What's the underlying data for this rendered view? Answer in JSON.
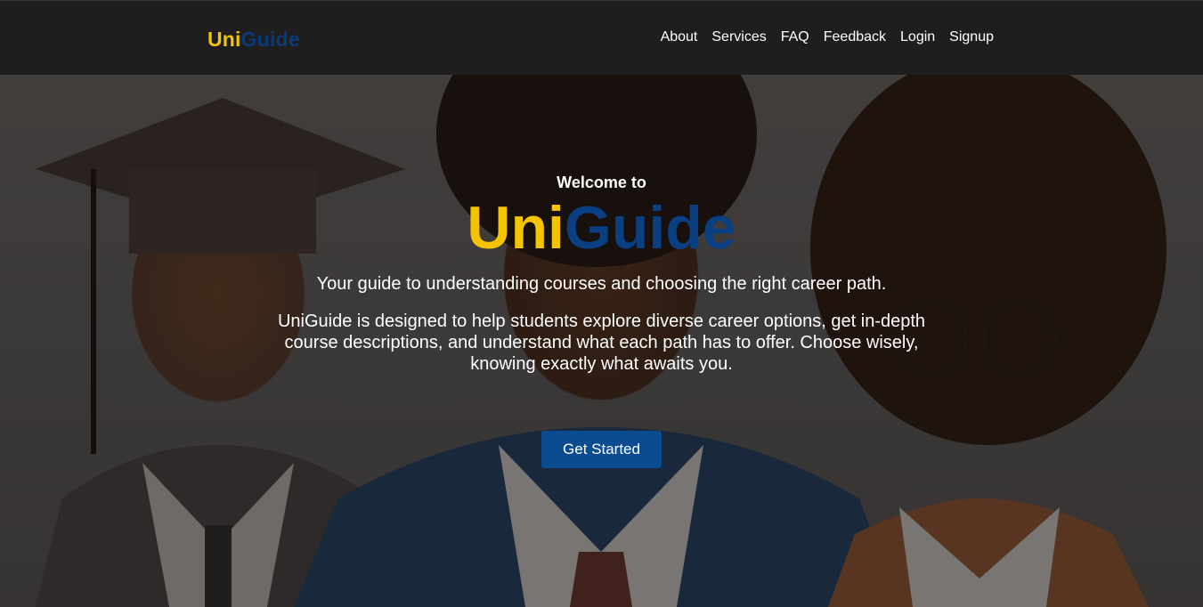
{
  "navbar": {
    "brand": {
      "part1": "Uni",
      "part2": "Guide"
    },
    "links": [
      {
        "label": "About"
      },
      {
        "label": "Services"
      },
      {
        "label": "FAQ"
      },
      {
        "label": "Feedback"
      },
      {
        "label": "Login"
      },
      {
        "label": "Signup"
      }
    ]
  },
  "hero": {
    "welcome": "Welcome to",
    "title": {
      "part1": "Uni",
      "part2": "Guide"
    },
    "tagline": "Your guide to understanding courses and choosing the right career path.",
    "description": "UniGuide is designed to help students explore diverse career options, get in-depth course descriptions, and understand what each path has to offer. Choose wisely, knowing exactly what awaits you.",
    "cta_label": "Get Started"
  },
  "colors": {
    "brand_yellow": "#f5c400",
    "brand_blue": "#0a3f82",
    "navbar_bg": "#1e1e1e",
    "button_bg": "#0b4b8f"
  }
}
